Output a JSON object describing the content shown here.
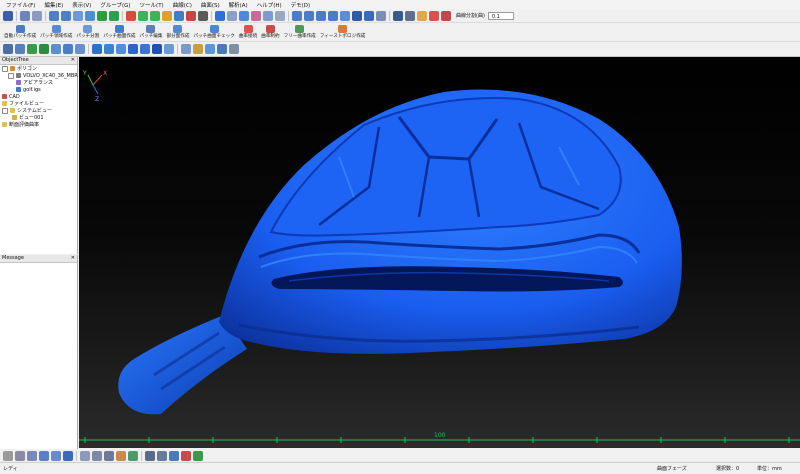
{
  "menu": [
    "ファイル(F)",
    "編集(E)",
    "表示(V)",
    "グループ(G)",
    "ツール(T)",
    "曲線(C)",
    "曲面(S)",
    "解析(A)",
    "ヘルプ(H)",
    "デモ(D)"
  ],
  "toolbar": {
    "zoom_label": "曲線分割(曲)",
    "zoom_value": "0.1",
    "row2_buttons": [
      "自動パッチ作成",
      "パッチ領域作成",
      "パッチ分割",
      "パッチ曲面作成",
      "パッチ編集",
      "部分面作成",
      "パッチ曲面チェック",
      "曲率接続",
      "曲率制約",
      "フリー曲率作成",
      "フィーストポロジ作成"
    ]
  },
  "object_tree": {
    "title": "ObjectTree",
    "items": [
      "ポリゴン",
      "VOLVO_XC40_36_MBR",
      "アピアランス",
      "golf.igs",
      "CAD",
      "ファイルビュー",
      "システムビュー",
      "ビュー001",
      "断面評価曲率"
    ]
  },
  "message_panel": {
    "title": "Message"
  },
  "ruler": {
    "label": "100"
  },
  "statusbar": {
    "left": "レディ",
    "phase": "曲面フェーズ",
    "selected": "選択数：0",
    "unit": "単位：mm"
  },
  "axes": {
    "x": "X",
    "y": "Y",
    "z": "Z"
  },
  "colors": {
    "model": "#1a5ef0",
    "ruler": "#19c24a"
  }
}
